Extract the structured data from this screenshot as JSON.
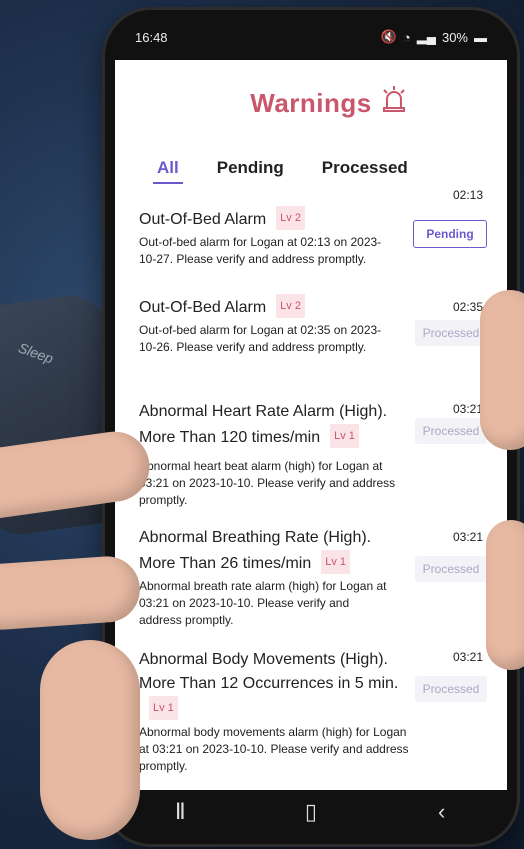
{
  "status_bar": {
    "time": "16:48",
    "battery": "30%"
  },
  "header": {
    "title": "Warnings"
  },
  "tabs": [
    {
      "label": "All",
      "active": true
    },
    {
      "label": "Pending",
      "active": false
    },
    {
      "label": "Processed",
      "active": false
    }
  ],
  "warnings": [
    {
      "title": "Out-Of-Bed Alarm",
      "level": "Lv 2",
      "time": "02:13",
      "desc": "Out-of-bed alarm for Logan at 02:13 on 2023-10-27.  Please verify and address promptly.",
      "status": "Pending"
    },
    {
      "title": "Out-Of-Bed Alarm",
      "level": "Lv 2",
      "time": "02:35",
      "desc": "Out-of-bed alarm for Logan at 02:35 on 2023-10-26. Please verify and address promptly.",
      "status": "Processed"
    },
    {
      "title": "Abnormal Heart Rate Alarm (High).  More Than 120 times/min",
      "level": "Lv 1",
      "time": "03:21",
      "desc": "Abnormal heart beat alarm (high) for Logan at 03:21 on 2023-10-10.  Please verify and address promptly.",
      "status": "Processed"
    },
    {
      "title": "Abnormal Breathing Rate (High). More Than 26 times/min",
      "level": "Lv 1",
      "time": "03:21",
      "desc": "Abnormal breath rate alarm (high) for Logan at 03:21 on 2023-10-10.  Please verify and address promptly.",
      "status": "Processed"
    },
    {
      "title": "Abnormal Body Movements (High).  More Than 12 Occurrences in 5 min.",
      "level": "Lv 1",
      "time": "03:21",
      "desc": "Abnormal body movements alarm (high) for Logan at 03:21 on 2023-10-10.  Please verify and address promptly.",
      "status": "Processed"
    }
  ],
  "icons": {
    "alarm": "alarm-siren-icon",
    "back": "back-icon",
    "home": "home-icon",
    "recents": "recents-icon"
  },
  "colors": {
    "accent": "#6a5acd",
    "title": "#c9566a",
    "level_bg": "#fbe4e8"
  },
  "background": {
    "pad_label": "Sleep"
  }
}
